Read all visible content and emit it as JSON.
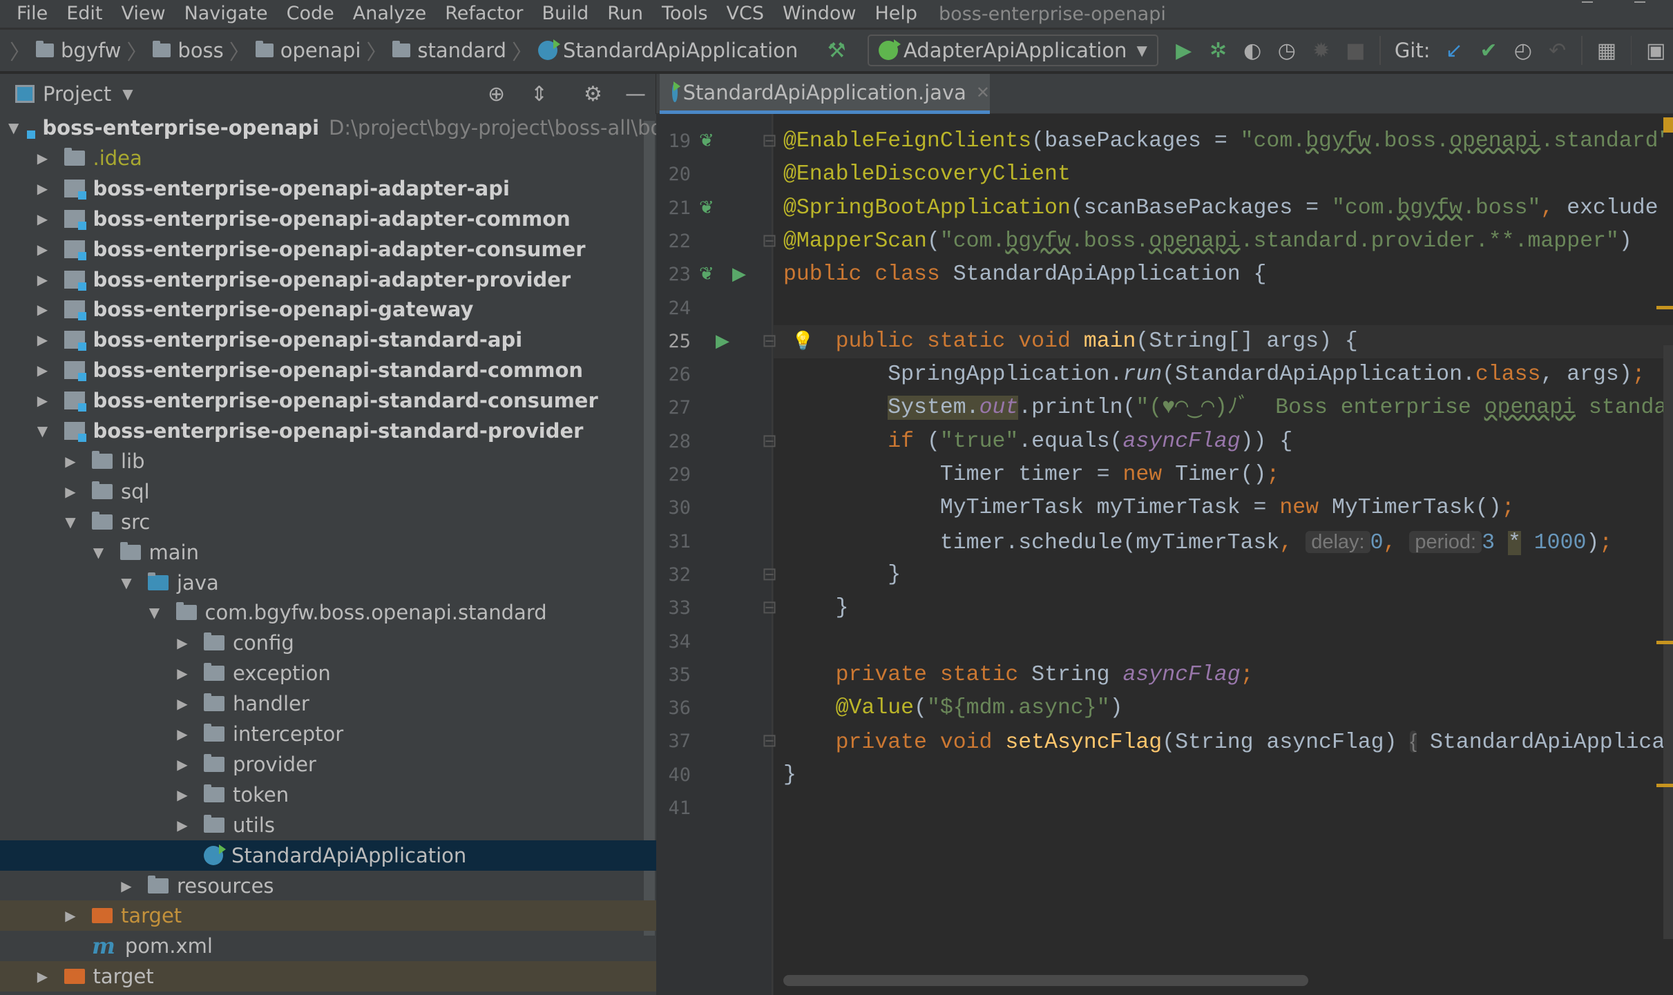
{
  "menu": {
    "items": [
      "File",
      "Edit",
      "View",
      "Navigate",
      "Code",
      "Analyze",
      "Refactor",
      "Build",
      "Run",
      "Tools",
      "VCS",
      "Window",
      "Help"
    ],
    "title": "boss-enterprise-openapi"
  },
  "breadcrumb": [
    "bgyfw",
    "boss",
    "openapi",
    "standard",
    "StandardApiApplication"
  ],
  "toolbar": {
    "run_config": "AdapterApiApplication",
    "git_label": "Git:",
    "icons": [
      "hammer-icon",
      "run-icon",
      "debug-icon",
      "coverage-icon",
      "profile-icon",
      "attach-icon",
      "stop-icon",
      "git-update-icon",
      "git-commit-icon",
      "git-history-icon",
      "git-rollback-icon",
      "project-structure-icon",
      "terminal-icon"
    ]
  },
  "project_panel": {
    "title": "Project",
    "icons": [
      "locate-icon",
      "collapse-all-icon",
      "gear-icon",
      "hide-icon"
    ]
  },
  "tree": [
    {
      "label": "boss-enterprise-openapi",
      "level": 0,
      "state": "open",
      "icon": "module",
      "bold": true,
      "path": "D:\\project\\bgy-project\\boss-all\\boss-"
    },
    {
      "label": ".idea",
      "level": 1,
      "state": "closed",
      "icon": "folder",
      "color": "#a8a830"
    },
    {
      "label": "boss-enterprise-openapi-adapter-api",
      "level": 1,
      "state": "closed",
      "icon": "module",
      "bold": true
    },
    {
      "label": "boss-enterprise-openapi-adapter-common",
      "level": 1,
      "state": "closed",
      "icon": "module",
      "bold": true
    },
    {
      "label": "boss-enterprise-openapi-adapter-consumer",
      "level": 1,
      "state": "closed",
      "icon": "module",
      "bold": true
    },
    {
      "label": "boss-enterprise-openapi-adapter-provider",
      "level": 1,
      "state": "closed",
      "icon": "module",
      "bold": true
    },
    {
      "label": "boss-enterprise-openapi-gateway",
      "level": 1,
      "state": "closed",
      "icon": "module",
      "bold": true
    },
    {
      "label": "boss-enterprise-openapi-standard-api",
      "level": 1,
      "state": "closed",
      "icon": "module",
      "bold": true
    },
    {
      "label": "boss-enterprise-openapi-standard-common",
      "level": 1,
      "state": "closed",
      "icon": "module",
      "bold": true
    },
    {
      "label": "boss-enterprise-openapi-standard-consumer",
      "level": 1,
      "state": "closed",
      "icon": "module",
      "bold": true
    },
    {
      "label": "boss-enterprise-openapi-standard-provider",
      "level": 1,
      "state": "open",
      "icon": "module",
      "bold": true
    },
    {
      "label": "lib",
      "level": 2,
      "state": "closed",
      "icon": "folder"
    },
    {
      "label": "sql",
      "level": 2,
      "state": "closed",
      "icon": "folder"
    },
    {
      "label": "src",
      "level": 2,
      "state": "open",
      "icon": "folder"
    },
    {
      "label": "main",
      "level": 3,
      "state": "open",
      "icon": "folder"
    },
    {
      "label": "java",
      "level": 4,
      "state": "open",
      "icon": "srcfolder"
    },
    {
      "label": "com.bgyfw.boss.openapi.standard",
      "level": 5,
      "state": "open",
      "icon": "folder"
    },
    {
      "label": "config",
      "level": 6,
      "state": "closed",
      "icon": "folder"
    },
    {
      "label": "exception",
      "level": 6,
      "state": "closed",
      "icon": "folder"
    },
    {
      "label": "handler",
      "level": 6,
      "state": "closed",
      "icon": "folder"
    },
    {
      "label": "interceptor",
      "level": 6,
      "state": "closed",
      "icon": "folder"
    },
    {
      "label": "provider",
      "level": 6,
      "state": "closed",
      "icon": "folder"
    },
    {
      "label": "token",
      "level": 6,
      "state": "closed",
      "icon": "folder"
    },
    {
      "label": "utils",
      "level": 6,
      "state": "closed",
      "icon": "folder"
    },
    {
      "label": "StandardApiApplication",
      "level": 6,
      "state": "none",
      "icon": "class",
      "selected": true
    },
    {
      "label": "resources",
      "level": 4,
      "state": "closed",
      "icon": "folder"
    },
    {
      "label": "target",
      "level": 2,
      "state": "closed",
      "icon": "excluded",
      "color": "#c3913b",
      "excluded": true
    },
    {
      "label": "pom.xml",
      "level": 2,
      "state": "none",
      "icon": "maven"
    },
    {
      "label": "target",
      "level": 1,
      "state": "closed",
      "icon": "excluded",
      "excluded": true
    }
  ],
  "editor": {
    "tab": "StandardApiApplication.java",
    "current_line": 25,
    "lines": [
      {
        "n": "19",
        "t": [
          [
            "@EnableFeignClients",
            "an"
          ],
          [
            "(basePackages = ",
            ""
          ],
          [
            "\"com.",
            "st"
          ],
          [
            "bgyfw",
            "st typo"
          ],
          [
            ".boss.",
            "st"
          ],
          [
            "openapi",
            "st typo"
          ],
          [
            ".standard\"",
            "st"
          ]
        ]
      },
      {
        "n": "20",
        "t": [
          [
            "@EnableDiscoveryClient",
            "an"
          ]
        ]
      },
      {
        "n": "21",
        "t": [
          [
            "@SpringBootApplication",
            "an"
          ],
          [
            "(scanBasePackages = ",
            ""
          ],
          [
            "\"com.",
            "st"
          ],
          [
            "bgyfw",
            "st typo"
          ],
          [
            ".boss\"",
            "st"
          ],
          [
            ", ",
            "kw"
          ],
          [
            "exclude",
            ""
          ]
        ]
      },
      {
        "n": "22",
        "t": [
          [
            "@MapperScan",
            "an"
          ],
          [
            "(",
            ""
          ],
          [
            "\"com.",
            "st"
          ],
          [
            "bgyfw",
            "st typo"
          ],
          [
            ".boss.",
            "st"
          ],
          [
            "openapi",
            "st typo"
          ],
          [
            ".standard.provider.**.mapper\"",
            "st"
          ],
          [
            ")",
            ""
          ]
        ]
      },
      {
        "n": "23",
        "t": [
          [
            "public class ",
            "kw"
          ],
          [
            "StandardApiApplication {",
            ""
          ]
        ]
      },
      {
        "n": "24",
        "t": []
      },
      {
        "n": "25",
        "t": [
          [
            "    ",
            ""
          ],
          [
            "public static void ",
            "kw"
          ],
          [
            "main",
            "fn"
          ],
          [
            "(String[] args) {",
            ""
          ]
        ]
      },
      {
        "n": "26",
        "t": [
          [
            "        SpringApplication.",
            ""
          ],
          [
            "run",
            "it"
          ],
          [
            "(StandardApiApplication.",
            ""
          ],
          [
            "class",
            "kw"
          ],
          [
            ", args)",
            ""
          ],
          [
            ";",
            "kw"
          ]
        ]
      },
      {
        "n": "27",
        "t": [
          [
            "        ",
            ""
          ],
          [
            "System.",
            "hl"
          ],
          [
            "out",
            "fld hl"
          ],
          [
            ".println(",
            ""
          ],
          [
            "\"(♥◠‿◠)ﾉﾞ  Boss enterprise ",
            "st"
          ],
          [
            "openapi",
            "st typo"
          ],
          [
            " standard",
            "st"
          ]
        ]
      },
      {
        "n": "28",
        "t": [
          [
            "        ",
            ""
          ],
          [
            "if ",
            "kw"
          ],
          [
            "(",
            ""
          ],
          [
            "\"true\"",
            "st"
          ],
          [
            ".equals(",
            ""
          ],
          [
            "asyncFlag",
            "fld"
          ],
          [
            ")) {",
            ""
          ]
        ]
      },
      {
        "n": "29",
        "t": [
          [
            "            Timer timer = ",
            ""
          ],
          [
            "new ",
            "kw"
          ],
          [
            "Timer()",
            ""
          ],
          [
            ";",
            "kw"
          ]
        ]
      },
      {
        "n": "30",
        "t": [
          [
            "            MyTimerTask myTimerTask = ",
            ""
          ],
          [
            "new ",
            "kw"
          ],
          [
            "MyTimerTask()",
            ""
          ],
          [
            ";",
            "kw"
          ]
        ]
      },
      {
        "n": "31",
        "t": [
          [
            "            timer.schedule(myTimerTask",
            ""
          ],
          [
            ", ",
            "kw"
          ],
          [
            " delay: ",
            "hint"
          ],
          [
            "0",
            "nm"
          ],
          [
            ", ",
            "kw"
          ],
          [
            " period: ",
            "hint"
          ],
          [
            "3 ",
            "nm"
          ],
          [
            "*",
            "hl"
          ],
          [
            " 1000",
            "nm"
          ],
          [
            ")",
            ""
          ],
          [
            ";",
            "kw"
          ]
        ]
      },
      {
        "n": "32",
        "t": [
          [
            "        }",
            ""
          ]
        ]
      },
      {
        "n": "33",
        "t": [
          [
            "    }",
            ""
          ]
        ]
      },
      {
        "n": "34",
        "t": []
      },
      {
        "n": "35",
        "t": [
          [
            "    ",
            ""
          ],
          [
            "private static ",
            "kw"
          ],
          [
            "String ",
            ""
          ],
          [
            "asyncFlag",
            "fld"
          ],
          [
            ";",
            "kw"
          ]
        ]
      },
      {
        "n": "36",
        "t": [
          [
            "    ",
            ""
          ],
          [
            "@Value",
            "an"
          ],
          [
            "(",
            ""
          ],
          [
            "\"${mdm.async}\"",
            "st"
          ],
          [
            ")",
            ""
          ]
        ]
      },
      {
        "n": "37",
        "t": [
          [
            "    ",
            ""
          ],
          [
            "private void ",
            "kw"
          ],
          [
            "setAsyncFlag",
            "fn"
          ],
          [
            "(String asyncFlag) ",
            ""
          ],
          [
            "{",
            "hint"
          ],
          [
            " StandardApiApplica",
            ""
          ]
        ]
      },
      {
        "n": "40",
        "t": [
          [
            "}",
            ""
          ]
        ]
      },
      {
        "n": "41",
        "t": []
      }
    ]
  },
  "colors": {
    "accent": "#4a88c7",
    "selection": "#0d293e",
    "run_green": "#59a869"
  }
}
